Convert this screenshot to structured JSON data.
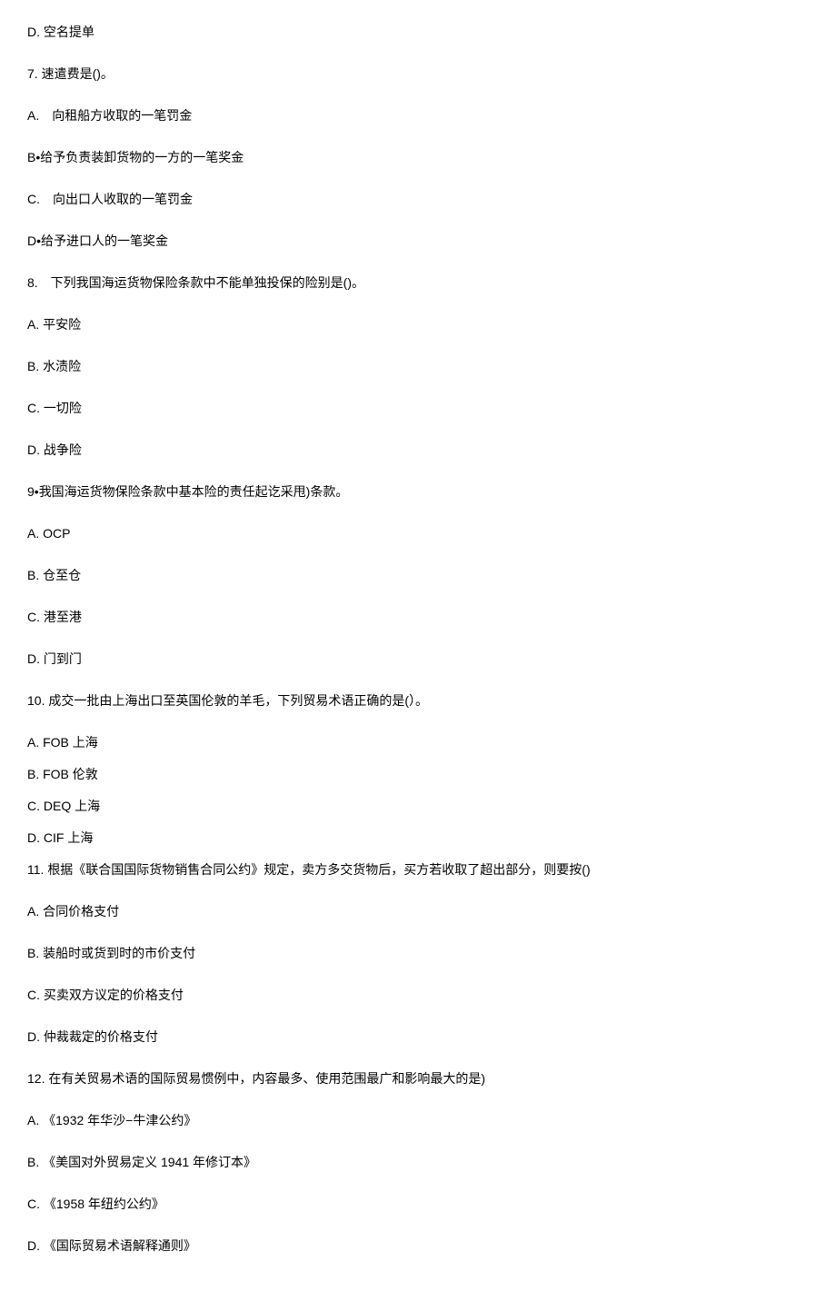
{
  "lines": [
    "D.  空名提单",
    "7.  速遣费是()。",
    "A. 向租船方收取的一笔罚金",
    "B•给予负责装卸货物的一方的一笔奖金",
    "C. 向出口人收取的一笔罚金",
    "D•给予进口人的一笔奖金",
    "8. 下列我国海运货物保险条款中不能单独投保的险别是()。",
    "A.  平安险",
    "B.  水渍险",
    "C.  一切险",
    "D.  战争险",
    "9•我国海运货物保险条款中基本险的责任起讫采甩)条款。",
    "A.  OCP",
    "B.  仓至仓",
    "C.  港至港",
    "D.  门到门",
    "10.  成交一批由上海出口至英国伦敦的羊毛，下列贸易术语正确的是(）。",
    "A.  FOB 上海",
    "B.  FOB 伦敦",
    "C.  DEQ 上海",
    "D.  CIF 上海",
    "11.  根据《联合国国际货物销售合同公约》规定，卖方多交货物后，买方若收取了超出部分，则要按()",
    "A.  合同价格支付",
    "B.  装船时或货到时的市价支付",
    "C.  买卖双方议定的价格支付",
    "D.  仲裁裁定的价格支付",
    "12.  在有关贸易术语的国际贸易惯例中，内容最多、使用范围最广和影响最大的是)",
    "A.  《1932 年华沙−牛津公约》",
    "B.  《美国对外贸易定义 1941 年修订本》",
    "C.  《1958 年纽约公约》",
    "D.  《国际贸易术语解释通则》"
  ],
  "tightIndices": [
    17,
    18,
    19,
    20
  ]
}
